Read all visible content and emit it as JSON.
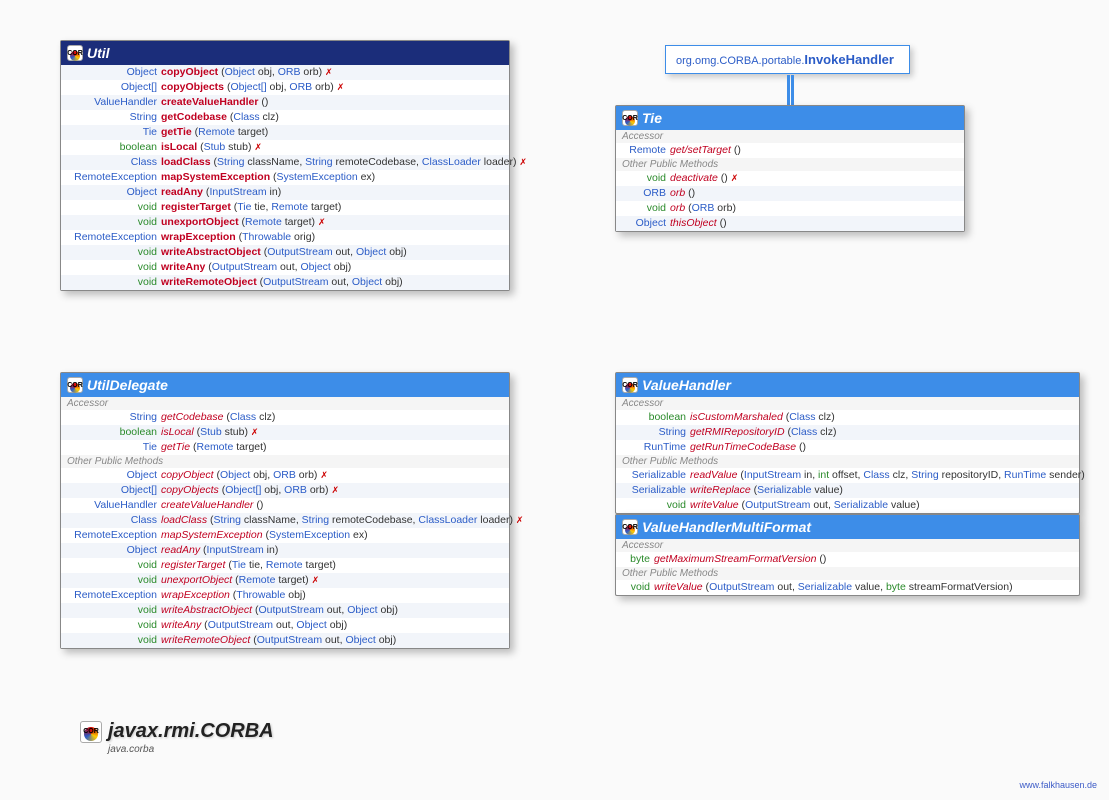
{
  "package": {
    "name": "javax.rmi.CORBA",
    "module": "java.corba",
    "iconLabel": "COR"
  },
  "footer": {
    "url": "www.falkhausen.de"
  },
  "extRef": {
    "pkg": "org.omg.CORBA.portable.",
    "name": "InvokeHandler"
  },
  "boxes": {
    "util": {
      "title": "Util",
      "methods": [
        {
          "ret": "Object",
          "name": "copyObject",
          "params": [
            [
              "Object",
              "obj"
            ],
            [
              "ORB",
              "orb"
            ]
          ],
          "throws": true
        },
        {
          "ret": "Object[]",
          "name": "copyObjects",
          "params": [
            [
              "Object[]",
              "obj"
            ],
            [
              "ORB",
              "orb"
            ]
          ],
          "throws": true
        },
        {
          "ret": "ValueHandler",
          "name": "createValueHandler",
          "params": []
        },
        {
          "ret": "String",
          "name": "getCodebase",
          "params": [
            [
              "Class",
              "clz"
            ]
          ]
        },
        {
          "ret": "Tie",
          "name": "getTie",
          "params": [
            [
              "Remote",
              "target"
            ]
          ]
        },
        {
          "ret": "boolean",
          "retKw": true,
          "name": "isLocal",
          "params": [
            [
              "Stub",
              "stub"
            ]
          ],
          "throws": true
        },
        {
          "ret": "Class",
          "name": "loadClass",
          "params": [
            [
              "String",
              "className"
            ],
            [
              "String",
              "remoteCodebase"
            ],
            [
              "ClassLoader",
              "loader"
            ]
          ],
          "throws": true
        },
        {
          "ret": "RemoteException",
          "name": "mapSystemException",
          "params": [
            [
              "SystemException",
              "ex"
            ]
          ]
        },
        {
          "ret": "Object",
          "name": "readAny",
          "params": [
            [
              "InputStream",
              "in"
            ]
          ]
        },
        {
          "ret": "void",
          "retKw": true,
          "name": "registerTarget",
          "params": [
            [
              "Tie",
              "tie"
            ],
            [
              "Remote",
              "target"
            ]
          ]
        },
        {
          "ret": "void",
          "retKw": true,
          "name": "unexportObject",
          "params": [
            [
              "Remote",
              "target"
            ]
          ],
          "throws": true
        },
        {
          "ret": "RemoteException",
          "name": "wrapException",
          "params": [
            [
              "Throwable",
              "orig"
            ]
          ]
        },
        {
          "ret": "void",
          "retKw": true,
          "name": "writeAbstractObject",
          "params": [
            [
              "OutputStream",
              "out"
            ],
            [
              "Object",
              "obj"
            ]
          ]
        },
        {
          "ret": "void",
          "retKw": true,
          "name": "writeAny",
          "params": [
            [
              "OutputStream",
              "out"
            ],
            [
              "Object",
              "obj"
            ]
          ]
        },
        {
          "ret": "void",
          "retKw": true,
          "name": "writeRemoteObject",
          "params": [
            [
              "OutputStream",
              "out"
            ],
            [
              "Object",
              "obj"
            ]
          ]
        }
      ]
    },
    "tie": {
      "title": "Tie",
      "sections": [
        {
          "label": "Accessor",
          "rows": [
            {
              "ret": "Remote",
              "name": "get/setTarget",
              "italic": true,
              "params": []
            }
          ]
        },
        {
          "label": "Other Public Methods",
          "rows": [
            {
              "ret": "void",
              "retKw": true,
              "name": "deactivate",
              "italic": true,
              "params": [],
              "throws": true
            },
            {
              "ret": "ORB",
              "name": "orb",
              "italic": true,
              "params": []
            },
            {
              "ret": "void",
              "retKw": true,
              "name": "orb",
              "italic": true,
              "params": [
                [
                  "ORB",
                  "orb"
                ]
              ]
            },
            {
              "ret": "Object",
              "name": "thisObject",
              "italic": true,
              "params": []
            }
          ]
        }
      ]
    },
    "utilDelegate": {
      "title": "UtilDelegate",
      "sections": [
        {
          "label": "Accessor",
          "rows": [
            {
              "ret": "String",
              "name": "getCodebase",
              "italic": true,
              "params": [
                [
                  "Class",
                  "clz"
                ]
              ]
            },
            {
              "ret": "boolean",
              "retKw": true,
              "name": "isLocal",
              "italic": true,
              "params": [
                [
                  "Stub",
                  "stub"
                ]
              ],
              "throws": true
            },
            {
              "ret": "Tie",
              "name": "getTie",
              "italic": true,
              "params": [
                [
                  "Remote",
                  "target"
                ]
              ]
            }
          ]
        },
        {
          "label": "Other Public Methods",
          "rows": [
            {
              "ret": "Object",
              "name": "copyObject",
              "italic": true,
              "params": [
                [
                  "Object",
                  "obj"
                ],
                [
                  "ORB",
                  "orb"
                ]
              ],
              "throws": true
            },
            {
              "ret": "Object[]",
              "name": "copyObjects",
              "italic": true,
              "params": [
                [
                  "Object[]",
                  "obj"
                ],
                [
                  "ORB",
                  "orb"
                ]
              ],
              "throws": true
            },
            {
              "ret": "ValueHandler",
              "name": "createValueHandler",
              "italic": true,
              "params": []
            },
            {
              "ret": "Class",
              "name": "loadClass",
              "italic": true,
              "params": [
                [
                  "String",
                  "className"
                ],
                [
                  "String",
                  "remoteCodebase"
                ],
                [
                  "ClassLoader",
                  "loader"
                ]
              ],
              "throws": true
            },
            {
              "ret": "RemoteException",
              "name": "mapSystemException",
              "italic": true,
              "params": [
                [
                  "SystemException",
                  "ex"
                ]
              ]
            },
            {
              "ret": "Object",
              "name": "readAny",
              "italic": true,
              "params": [
                [
                  "InputStream",
                  "in"
                ]
              ]
            },
            {
              "ret": "void",
              "retKw": true,
              "name": "registerTarget",
              "italic": true,
              "params": [
                [
                  "Tie",
                  "tie"
                ],
                [
                  "Remote",
                  "target"
                ]
              ]
            },
            {
              "ret": "void",
              "retKw": true,
              "name": "unexportObject",
              "italic": true,
              "params": [
                [
                  "Remote",
                  "target"
                ]
              ],
              "throws": true
            },
            {
              "ret": "RemoteException",
              "name": "wrapException",
              "italic": true,
              "params": [
                [
                  "Throwable",
                  "obj"
                ]
              ]
            },
            {
              "ret": "void",
              "retKw": true,
              "name": "writeAbstractObject",
              "italic": true,
              "params": [
                [
                  "OutputStream",
                  "out"
                ],
                [
                  "Object",
                  "obj"
                ]
              ]
            },
            {
              "ret": "void",
              "retKw": true,
              "name": "writeAny",
              "italic": true,
              "params": [
                [
                  "OutputStream",
                  "out"
                ],
                [
                  "Object",
                  "obj"
                ]
              ]
            },
            {
              "ret": "void",
              "retKw": true,
              "name": "writeRemoteObject",
              "italic": true,
              "params": [
                [
                  "OutputStream",
                  "out"
                ],
                [
                  "Object",
                  "obj"
                ]
              ]
            }
          ]
        }
      ]
    },
    "valueHandler": {
      "title": "ValueHandler",
      "sections": [
        {
          "label": "Accessor",
          "rows": [
            {
              "ret": "boolean",
              "retKw": true,
              "name": "isCustomMarshaled",
              "italic": true,
              "params": [
                [
                  "Class",
                  "clz"
                ]
              ]
            },
            {
              "ret": "String",
              "name": "getRMIRepositoryID",
              "italic": true,
              "params": [
                [
                  "Class",
                  "clz"
                ]
              ]
            },
            {
              "ret": "RunTime",
              "name": "getRunTimeCodeBase",
              "italic": true,
              "params": []
            }
          ]
        },
        {
          "label": "Other Public Methods",
          "rows": [
            {
              "ret": "Serializable",
              "name": "readValue",
              "italic": true,
              "params": [
                [
                  "InputStream",
                  "in"
                ],
                [
                  "int",
                  "offset"
                ],
                [
                  "Class",
                  "clz"
                ],
                [
                  "String",
                  "repositoryID"
                ],
                [
                  "RunTime",
                  "sender"
                ]
              ]
            },
            {
              "ret": "Serializable",
              "name": "writeReplace",
              "italic": true,
              "params": [
                [
                  "Serializable",
                  "value"
                ]
              ]
            },
            {
              "ret": "void",
              "retKw": true,
              "name": "writeValue",
              "italic": true,
              "params": [
                [
                  "OutputStream",
                  "out"
                ],
                [
                  "Serializable",
                  "value"
                ]
              ]
            }
          ]
        }
      ]
    },
    "vhMulti": {
      "title": "ValueHandlerMultiFormat",
      "sections": [
        {
          "label": "Accessor",
          "rows": [
            {
              "ret": "byte",
              "retKw": true,
              "name": "getMaximumStreamFormatVersion",
              "italic": true,
              "params": []
            }
          ]
        },
        {
          "label": "Other Public Methods",
          "rows": [
            {
              "ret": "void",
              "retKw": true,
              "name": "writeValue",
              "italic": true,
              "params": [
                [
                  "OutputStream",
                  "out"
                ],
                [
                  "Serializable",
                  "value"
                ],
                [
                  "byte",
                  "streamFormatVersion"
                ]
              ]
            }
          ]
        }
      ]
    }
  }
}
